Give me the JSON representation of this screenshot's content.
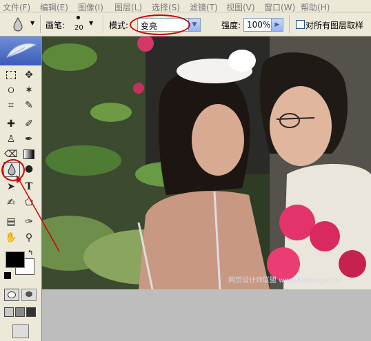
{
  "menubar": {
    "items": [
      "文件(F)",
      "编辑(E)",
      "图像(I)",
      "图层(L)",
      "选择(S)",
      "滤镜(T)",
      "视图(V)",
      "窗口(W)",
      "帮助(H)"
    ]
  },
  "options_bar": {
    "brush_label": "画笔:",
    "brush_size": "20",
    "mode_label": "模式:",
    "mode_value": "变亮",
    "strength_label": "强度:",
    "strength_value": "100%",
    "sample_all_layers_label": "对所有图层取样",
    "sample_all_layers_checked": false,
    "highlight_color": "#cc0000"
  },
  "toolbox": {
    "selected_tool": "blur-tool",
    "foreground_color": "#000000",
    "background_color": "#ffffff",
    "tools": [
      "marquee-tool",
      "move-tool",
      "lasso-tool",
      "magic-wand-tool",
      "crop-tool",
      "slice-tool",
      "healing-brush-tool",
      "brush-tool",
      "clone-stamp-tool",
      "history-brush-tool",
      "eraser-tool",
      "gradient-tool",
      "blur-tool",
      "dodge-tool",
      "path-selection-tool",
      "type-tool",
      "pen-tool",
      "shape-tool",
      "notes-tool",
      "eyedropper-tool",
      "hand-tool",
      "zoom-tool"
    ]
  },
  "canvas": {
    "watermark": "网页设计师联盟 www.68design.net"
  }
}
